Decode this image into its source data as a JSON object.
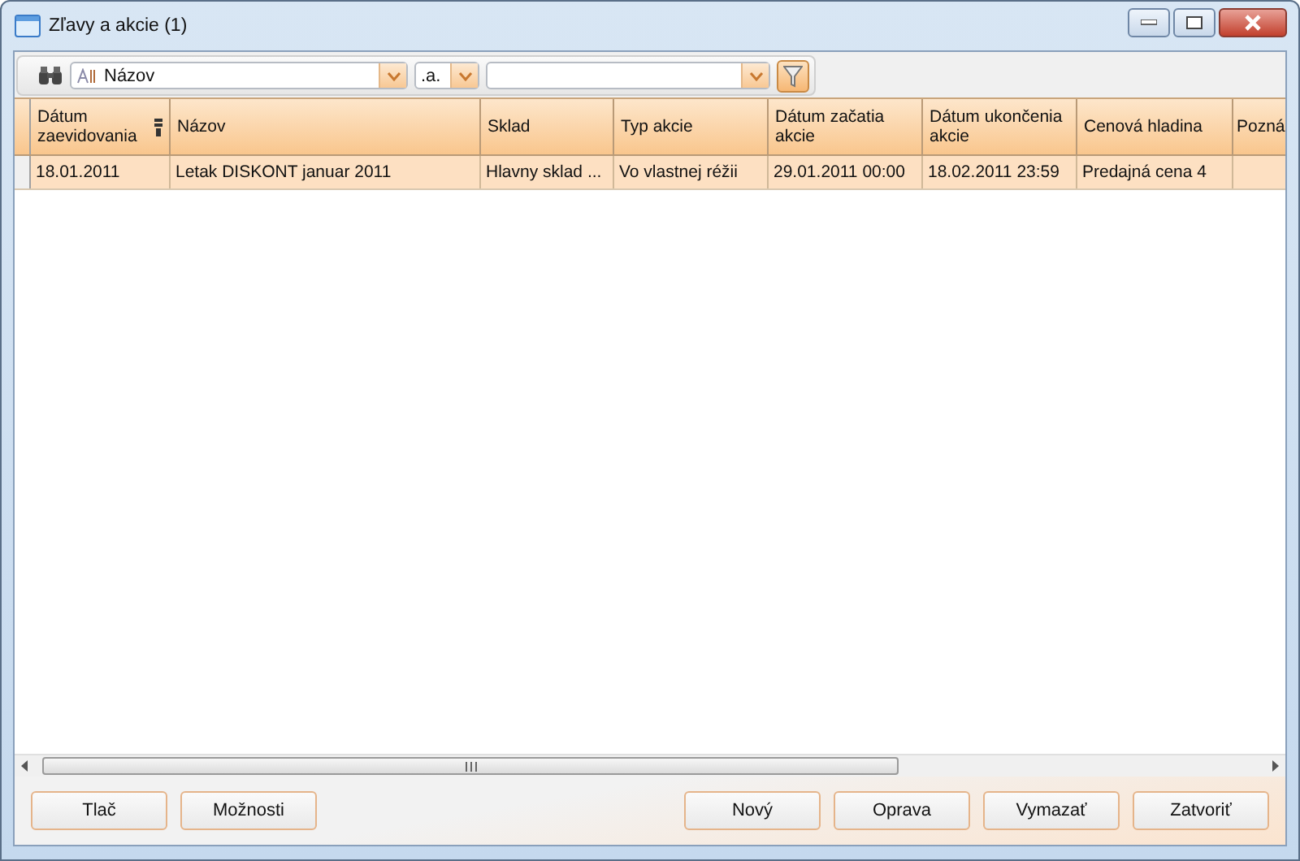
{
  "window": {
    "title": "Zľavy a akcie (1)"
  },
  "toolbar": {
    "field": "Názov",
    "operator": ".a."
  },
  "table": {
    "columns": [
      "Dátum zaevidovania",
      "Názov",
      "Sklad",
      "Typ akcie",
      "Dátum začatia akcie",
      "Dátum ukončenia akcie",
      "Cenová hladina",
      "Pozná"
    ],
    "rows": [
      {
        "selected": true,
        "cells": [
          "18.01.2011",
          "Letak DISKONT januar 2011",
          "Hlavny sklad ...",
          "Vo vlastnej réžii",
          "29.01.2011 00:00",
          "18.02.2011 23:59",
          "Predajná cena 4",
          ""
        ]
      }
    ]
  },
  "buttons_left": [
    "Tlač",
    "Možnosti"
  ],
  "buttons_right": [
    "Nový",
    "Oprava",
    "Vymazať",
    "Zatvoriť"
  ]
}
